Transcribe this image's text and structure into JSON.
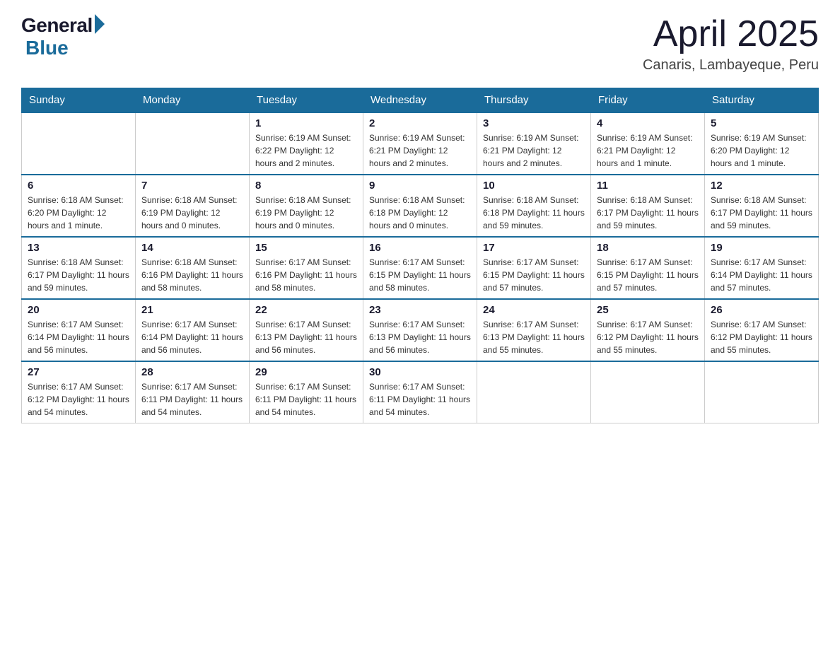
{
  "logo": {
    "general": "General",
    "blue": "Blue",
    "tagline": "Blue"
  },
  "header": {
    "month": "April 2025",
    "location": "Canaris, Lambayeque, Peru"
  },
  "weekdays": [
    "Sunday",
    "Monday",
    "Tuesday",
    "Wednesday",
    "Thursday",
    "Friday",
    "Saturday"
  ],
  "weeks": [
    [
      {
        "day": "",
        "info": ""
      },
      {
        "day": "",
        "info": ""
      },
      {
        "day": "1",
        "info": "Sunrise: 6:19 AM\nSunset: 6:22 PM\nDaylight: 12 hours\nand 2 minutes."
      },
      {
        "day": "2",
        "info": "Sunrise: 6:19 AM\nSunset: 6:21 PM\nDaylight: 12 hours\nand 2 minutes."
      },
      {
        "day": "3",
        "info": "Sunrise: 6:19 AM\nSunset: 6:21 PM\nDaylight: 12 hours\nand 2 minutes."
      },
      {
        "day": "4",
        "info": "Sunrise: 6:19 AM\nSunset: 6:21 PM\nDaylight: 12 hours\nand 1 minute."
      },
      {
        "day": "5",
        "info": "Sunrise: 6:19 AM\nSunset: 6:20 PM\nDaylight: 12 hours\nand 1 minute."
      }
    ],
    [
      {
        "day": "6",
        "info": "Sunrise: 6:18 AM\nSunset: 6:20 PM\nDaylight: 12 hours\nand 1 minute."
      },
      {
        "day": "7",
        "info": "Sunrise: 6:18 AM\nSunset: 6:19 PM\nDaylight: 12 hours\nand 0 minutes."
      },
      {
        "day": "8",
        "info": "Sunrise: 6:18 AM\nSunset: 6:19 PM\nDaylight: 12 hours\nand 0 minutes."
      },
      {
        "day": "9",
        "info": "Sunrise: 6:18 AM\nSunset: 6:18 PM\nDaylight: 12 hours\nand 0 minutes."
      },
      {
        "day": "10",
        "info": "Sunrise: 6:18 AM\nSunset: 6:18 PM\nDaylight: 11 hours\nand 59 minutes."
      },
      {
        "day": "11",
        "info": "Sunrise: 6:18 AM\nSunset: 6:17 PM\nDaylight: 11 hours\nand 59 minutes."
      },
      {
        "day": "12",
        "info": "Sunrise: 6:18 AM\nSunset: 6:17 PM\nDaylight: 11 hours\nand 59 minutes."
      }
    ],
    [
      {
        "day": "13",
        "info": "Sunrise: 6:18 AM\nSunset: 6:17 PM\nDaylight: 11 hours\nand 59 minutes."
      },
      {
        "day": "14",
        "info": "Sunrise: 6:18 AM\nSunset: 6:16 PM\nDaylight: 11 hours\nand 58 minutes."
      },
      {
        "day": "15",
        "info": "Sunrise: 6:17 AM\nSunset: 6:16 PM\nDaylight: 11 hours\nand 58 minutes."
      },
      {
        "day": "16",
        "info": "Sunrise: 6:17 AM\nSunset: 6:15 PM\nDaylight: 11 hours\nand 58 minutes."
      },
      {
        "day": "17",
        "info": "Sunrise: 6:17 AM\nSunset: 6:15 PM\nDaylight: 11 hours\nand 57 minutes."
      },
      {
        "day": "18",
        "info": "Sunrise: 6:17 AM\nSunset: 6:15 PM\nDaylight: 11 hours\nand 57 minutes."
      },
      {
        "day": "19",
        "info": "Sunrise: 6:17 AM\nSunset: 6:14 PM\nDaylight: 11 hours\nand 57 minutes."
      }
    ],
    [
      {
        "day": "20",
        "info": "Sunrise: 6:17 AM\nSunset: 6:14 PM\nDaylight: 11 hours\nand 56 minutes."
      },
      {
        "day": "21",
        "info": "Sunrise: 6:17 AM\nSunset: 6:14 PM\nDaylight: 11 hours\nand 56 minutes."
      },
      {
        "day": "22",
        "info": "Sunrise: 6:17 AM\nSunset: 6:13 PM\nDaylight: 11 hours\nand 56 minutes."
      },
      {
        "day": "23",
        "info": "Sunrise: 6:17 AM\nSunset: 6:13 PM\nDaylight: 11 hours\nand 56 minutes."
      },
      {
        "day": "24",
        "info": "Sunrise: 6:17 AM\nSunset: 6:13 PM\nDaylight: 11 hours\nand 55 minutes."
      },
      {
        "day": "25",
        "info": "Sunrise: 6:17 AM\nSunset: 6:12 PM\nDaylight: 11 hours\nand 55 minutes."
      },
      {
        "day": "26",
        "info": "Sunrise: 6:17 AM\nSunset: 6:12 PM\nDaylight: 11 hours\nand 55 minutes."
      }
    ],
    [
      {
        "day": "27",
        "info": "Sunrise: 6:17 AM\nSunset: 6:12 PM\nDaylight: 11 hours\nand 54 minutes."
      },
      {
        "day": "28",
        "info": "Sunrise: 6:17 AM\nSunset: 6:11 PM\nDaylight: 11 hours\nand 54 minutes."
      },
      {
        "day": "29",
        "info": "Sunrise: 6:17 AM\nSunset: 6:11 PM\nDaylight: 11 hours\nand 54 minutes."
      },
      {
        "day": "30",
        "info": "Sunrise: 6:17 AM\nSunset: 6:11 PM\nDaylight: 11 hours\nand 54 minutes."
      },
      {
        "day": "",
        "info": ""
      },
      {
        "day": "",
        "info": ""
      },
      {
        "day": "",
        "info": ""
      }
    ]
  ]
}
